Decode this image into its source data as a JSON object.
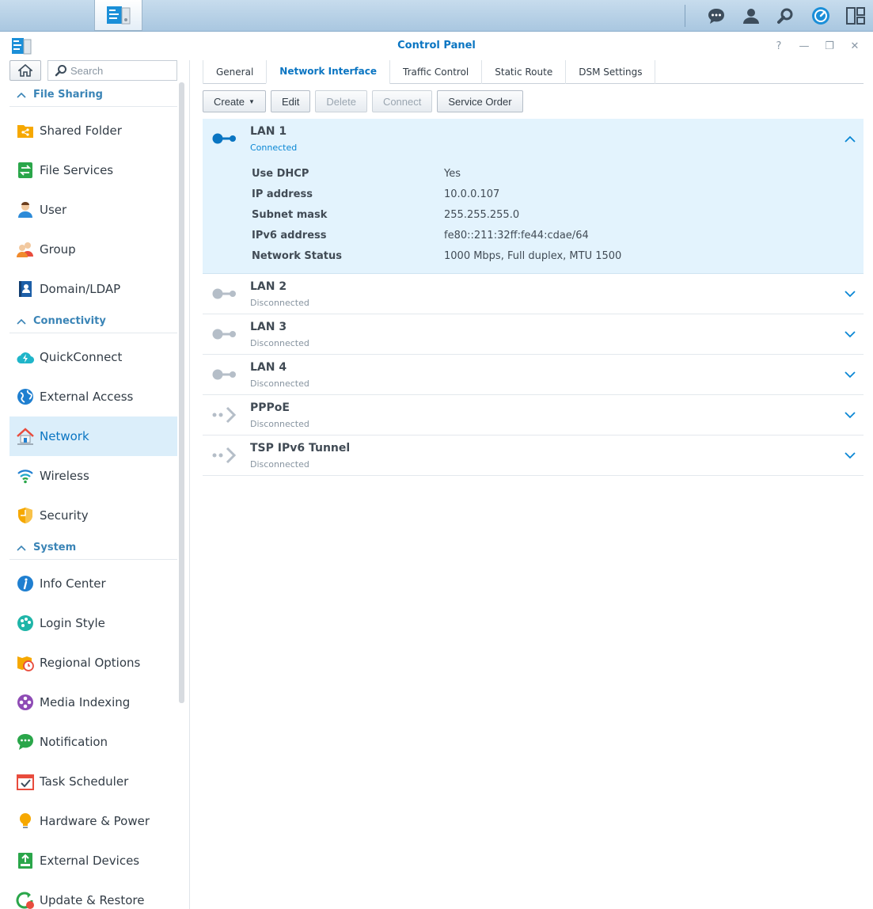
{
  "window": {
    "title": "Control Panel",
    "help": "?",
    "minimize": "—",
    "restore": "❐",
    "close": "✕"
  },
  "sidebar": {
    "search_placeholder": "Search",
    "sections": [
      {
        "label": "File Sharing"
      },
      {
        "label": "Connectivity"
      },
      {
        "label": "System"
      }
    ],
    "items": [
      {
        "label": "Shared Folder",
        "icon": "shared-folder-icon"
      },
      {
        "label": "File Services",
        "icon": "file-services-icon"
      },
      {
        "label": "User",
        "icon": "user-icon"
      },
      {
        "label": "Group",
        "icon": "group-icon"
      },
      {
        "label": "Domain/LDAP",
        "icon": "domain-ldap-icon"
      },
      {
        "label": "QuickConnect",
        "icon": "quickconnect-icon"
      },
      {
        "label": "External Access",
        "icon": "external-access-icon"
      },
      {
        "label": "Network",
        "icon": "network-icon",
        "active": true
      },
      {
        "label": "Wireless",
        "icon": "wireless-icon"
      },
      {
        "label": "Security",
        "icon": "security-icon"
      },
      {
        "label": "Info Center",
        "icon": "info-center-icon"
      },
      {
        "label": "Login Style",
        "icon": "login-style-icon"
      },
      {
        "label": "Regional Options",
        "icon": "regional-options-icon"
      },
      {
        "label": "Media Indexing",
        "icon": "media-indexing-icon"
      },
      {
        "label": "Notification",
        "icon": "notification-icon"
      },
      {
        "label": "Task Scheduler",
        "icon": "task-scheduler-icon"
      },
      {
        "label": "Hardware & Power",
        "icon": "hardware-power-icon"
      },
      {
        "label": "External Devices",
        "icon": "external-devices-icon"
      },
      {
        "label": "Update & Restore",
        "icon": "update-restore-icon"
      }
    ]
  },
  "tabs": [
    {
      "label": "General"
    },
    {
      "label": "Network Interface",
      "active": true
    },
    {
      "label": "Traffic Control"
    },
    {
      "label": "Static Route"
    },
    {
      "label": "DSM Settings"
    }
  ],
  "toolbar": {
    "create": "Create",
    "edit": "Edit",
    "delete": "Delete",
    "connect": "Connect",
    "service_order": "Service Order"
  },
  "interfaces": [
    {
      "name": "LAN 1",
      "status": "Connected",
      "expanded": true,
      "details": [
        {
          "label": "Use DHCP",
          "value": "Yes"
        },
        {
          "label": "IP address",
          "value": "10.0.0.107"
        },
        {
          "label": "Subnet mask",
          "value": "255.255.255.0"
        },
        {
          "label": "IPv6 address",
          "value": "fe80::211:32ff:fe44:cdae/64"
        },
        {
          "label": "Network Status",
          "value": "1000 Mbps, Full duplex, MTU 1500"
        }
      ]
    },
    {
      "name": "LAN 2",
      "status": "Disconnected"
    },
    {
      "name": "LAN 3",
      "status": "Disconnected"
    },
    {
      "name": "LAN 4",
      "status": "Disconnected"
    },
    {
      "name": "PPPoE",
      "status": "Disconnected"
    },
    {
      "name": "TSP IPv6 Tunnel",
      "status": "Disconnected"
    }
  ],
  "colors": {
    "accent": "#0a75c2",
    "active_bg": "#dbeefa",
    "expanded_bg": "#e3f3fd"
  }
}
